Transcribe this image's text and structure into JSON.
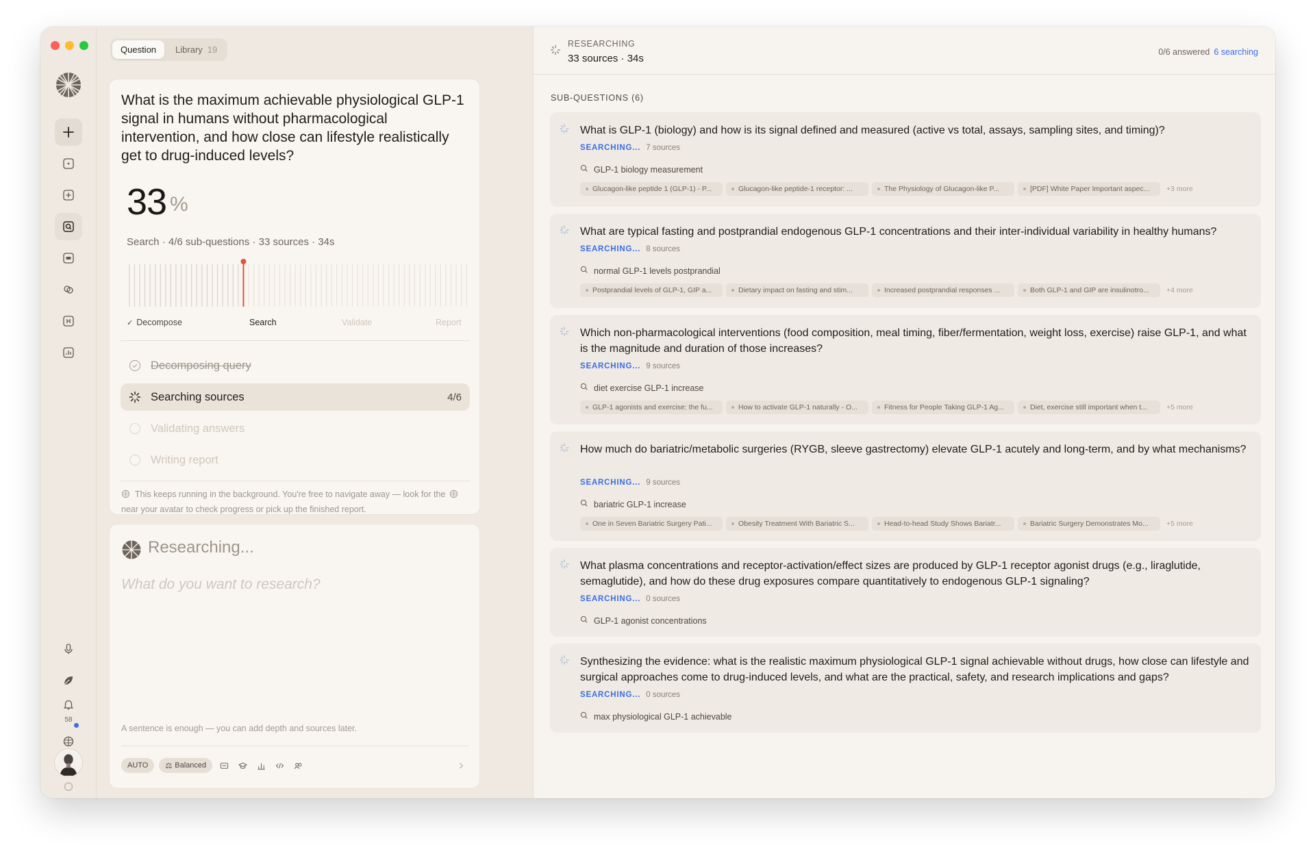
{
  "sidebar": {
    "notification_count": "58"
  },
  "tabs": [
    {
      "label": "Question",
      "count": ""
    },
    {
      "label": "Library",
      "count": "19"
    }
  ],
  "question": {
    "text": "What is the maximum achievable physiological GLP-1 signal in humans without pharmacological intervention, and how close can lifestyle realistically get to drug-induced levels?",
    "progress_value": "33",
    "progress_unit": "%",
    "meta": "Search · 4/6 sub-questions · 33 sources · 34s",
    "stages": [
      "Decompose",
      "Search",
      "Validate",
      "Report"
    ],
    "steps": [
      {
        "label": "Decomposing query",
        "count": ""
      },
      {
        "label": "Searching sources",
        "count": "4/6"
      },
      {
        "label": "Validating answers",
        "count": ""
      },
      {
        "label": "Writing report",
        "count": ""
      }
    ],
    "note_part1": "This keeps running in the background. You're free to navigate away — look for the",
    "note_part2": "near your avatar to check progress or pick up the finished report."
  },
  "composer": {
    "title": "Researching...",
    "placeholder": "What do you want to research?",
    "hint": "A sentence is enough — you can add depth and sources later.",
    "auto_label": "AUTO",
    "mode_label": "Balanced"
  },
  "header": {
    "label": "RESEARCHING",
    "subtitle": "33 sources · 34s",
    "answered": "0/6 answered",
    "searching": "6 searching"
  },
  "subquestions_header": "SUB-QUESTIONS (6)",
  "subquestions": [
    {
      "title": "What is GLP-1 (biology) and how is its signal defined and measured (active vs total, assays, sampling sites, and timing)?",
      "status": "SEARCHING...",
      "sources": "7 sources",
      "query": "GLP-1 biology measurement",
      "chips": [
        "Glucagon-like peptide 1 (GLP-1) - P...",
        "Glucagon-like peptide-1 receptor: ...",
        "The Physiology of Glucagon-like P...",
        "[PDF] White Paper Important aspec..."
      ],
      "more": "+3 more"
    },
    {
      "title": "What are typical fasting and postprandial endogenous GLP-1 concentrations and their inter-individual variability in healthy humans?",
      "status": "SEARCHING...",
      "sources": "8 sources",
      "query": "normal GLP-1 levels postprandial",
      "chips": [
        "Postprandial levels of GLP-1, GIP a...",
        "Dietary impact on fasting and stim...",
        "Increased postprandial responses ...",
        "Both GLP-1 and GIP are insulinotro..."
      ],
      "more": "+4 more"
    },
    {
      "title": "Which non-pharmacological interventions (food composition, meal timing, fiber/fermentation, weight loss, exercise) raise GLP-1, and what is the magnitude and duration of those increases?",
      "status": "SEARCHING...",
      "sources": "9 sources",
      "query": "diet exercise GLP-1 increase",
      "chips": [
        "GLP-1 agonists and exercise: the fu...",
        "How to activate GLP-1 naturally - O...",
        "Fitness for People Taking GLP-1 Ag...",
        "Diet, exercise still important when t..."
      ],
      "more": "+5 more"
    },
    {
      "title": "How much do bariatric/metabolic surgeries (RYGB, sleeve gastrectomy) elevate GLP-1 acutely and long-term, and by what mechanisms?",
      "status": "SEARCHING...",
      "sources": "9 sources",
      "query": "bariatric GLP-1 increase",
      "chips": [
        "One in Seven Bariatric Surgery Pati...",
        "Obesity Treatment With Bariatric S...",
        "Head-to-head Study Shows Bariatr...",
        "Bariatric Surgery Demonstrates Mo..."
      ],
      "more": "+5 more"
    },
    {
      "title": "What plasma concentrations and receptor-activation/effect sizes are produced by GLP-1 receptor agonist drugs (e.g., liraglutide, semaglutide), and how do these drug exposures compare quantitatively to endogenous GLP-1 signaling?",
      "status": "SEARCHING...",
      "sources": "0 sources",
      "query": "GLP-1 agonist concentrations",
      "chips": [],
      "more": ""
    },
    {
      "title": "Synthesizing the evidence: what is the realistic maximum physiological GLP-1 signal achievable without drugs, how close can lifestyle and surgical approaches come to drug-induced levels, and what are the practical, safety, and research implications and gaps?",
      "status": "SEARCHING...",
      "sources": "0 sources",
      "query": "max physiological GLP-1 achievable",
      "chips": [],
      "more": ""
    }
  ]
}
